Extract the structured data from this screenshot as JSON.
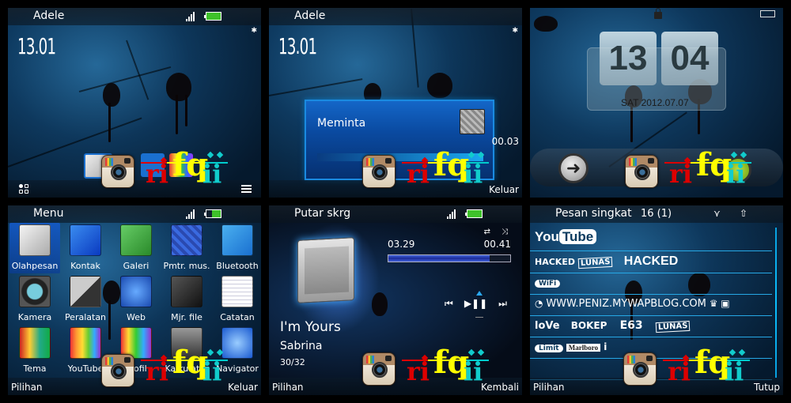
{
  "screens": {
    "standby": {
      "operator": "Adele",
      "time": "13.01",
      "soft_left_icon": "shortcuts-grid-icon",
      "soft_right_icon": "menu-lines-icon"
    },
    "loading": {
      "operator": "Adele",
      "time": "13.01",
      "dialog_title": "Meminta",
      "dialog_progress": 1.0,
      "timer": "00.03",
      "soft_right": "Keluar"
    },
    "lockscreen": {
      "hour": "13",
      "minute": "04",
      "date": "SAT 2012.07.07",
      "slide_icon": "arrow-right-icon"
    },
    "menu": {
      "title": "Menu",
      "items": [
        {
          "label": "Olahpesan",
          "icon": "messaging-icon",
          "selected": true
        },
        {
          "label": "Kontak",
          "icon": "contacts-icon"
        },
        {
          "label": "Galeri",
          "icon": "gallery-icon"
        },
        {
          "label": "Pmtr. mus.",
          "icon": "music-player-icon"
        },
        {
          "label": "Bluetooth",
          "icon": "bluetooth-icon"
        },
        {
          "label": "Kamera",
          "icon": "camera-icon"
        },
        {
          "label": "Peralatan",
          "icon": "tools-icon"
        },
        {
          "label": "Web",
          "icon": "web-globe-icon"
        },
        {
          "label": "Mjr. file",
          "icon": "file-manager-icon"
        },
        {
          "label": "Catatan",
          "icon": "notes-icon"
        },
        {
          "label": "Tema",
          "icon": "themes-icon"
        },
        {
          "label": "YouTube",
          "icon": "youtube-tv-icon"
        },
        {
          "label": "Profil",
          "icon": "profiles-icon"
        },
        {
          "label": "Kalkulator",
          "icon": "calculator-icon"
        },
        {
          "label": "Navigator",
          "icon": "navigator-compass-icon"
        }
      ],
      "soft_left": "Pilihan",
      "soft_right": "Keluar"
    },
    "music": {
      "title": "Putar skrg",
      "elapsed": "03.29",
      "remaining": "00.41",
      "progress": 0.83,
      "song": "I'm Yours",
      "artist": "Sabrina",
      "track": "30/32",
      "controls": {
        "prev": "⏮",
        "playpause": "▶❚❚",
        "next": "⏭"
      },
      "soft_left": "Pilihan",
      "soft_right": "Kembali"
    },
    "sms": {
      "title": "Pesan singkat",
      "count": "16 (1)",
      "rows": [
        {
          "items": [
            "You",
            "Tube"
          ]
        },
        {
          "items": [
            "HACKED",
            "LUNAS",
            "HACKED"
          ]
        },
        {
          "items": [
            "WiFi"
          ]
        },
        {
          "items": [
            "WWW.PENIZ.MYWAPBLOG.COM"
          ]
        },
        {
          "items": [
            "loVe",
            "BOKEP",
            "E63",
            "LUNAS"
          ]
        },
        {
          "items": [
            "Limit",
            "Marlboro",
            "i"
          ]
        }
      ],
      "soft_left": "Pilihan",
      "soft_right": "Tutup"
    }
  },
  "watermark": {
    "text": "rifqii",
    "r": "ri",
    "f": "fq",
    "ii": "ii",
    "colors": {
      "red": "#dd0000",
      "yellow": "#ffff00",
      "cyan": "#11cccc"
    }
  }
}
